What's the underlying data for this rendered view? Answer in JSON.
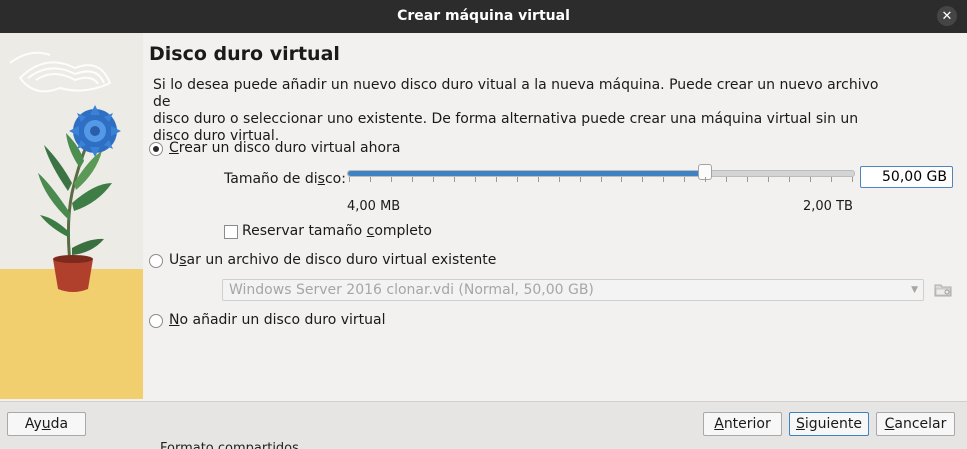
{
  "window": {
    "title": "Crear máquina virtual",
    "close_glyph": "✕"
  },
  "page": {
    "heading": "Disco duro virtual",
    "description_line1": "Si lo desea puede añadir un nuevo disco duro vitual a la nueva máquina. Puede crear un nuevo archivo de",
    "description_line2": "disco duro o seleccionar uno existente. De forma alternativa puede crear una máquina virtual sin un",
    "description_line3": "disco duro virtual."
  },
  "options": {
    "create_new": {
      "label_pre": "",
      "label_ul": "C",
      "label_post": "rear un disco duro virtual ahora",
      "selected": true
    },
    "use_existing": {
      "label_pre": "U",
      "label_ul": "s",
      "label_post": "ar un archivo de disco duro virtual existente",
      "selected": false
    },
    "no_disk": {
      "label_pre": "",
      "label_ul": "N",
      "label_post": "o añadir un disco duro virtual",
      "selected": false
    }
  },
  "disk_size": {
    "label_pre": "Tamaño de di",
    "label_ul": "s",
    "label_post": "co:",
    "value": "50,00 GB",
    "slider_fraction": 0.705,
    "min_label": "4,00 MB",
    "max_label": "2,00 TB"
  },
  "reserve": {
    "label_pre": "Reservar tamaño ",
    "label_ul": "c",
    "label_post": "ompleto",
    "checked": false
  },
  "existing_file": {
    "selected_value": "Windows Server 2016 clonar.vdi (Normal, 50,00 GB)",
    "arrow_glyph": "▼"
  },
  "buttons": {
    "help": {
      "pre": "Ay",
      "ul": "u",
      "post": "da"
    },
    "back": {
      "pre": "",
      "ul": "A",
      "post": "nterior"
    },
    "next": {
      "pre": "",
      "ul": "S",
      "post": "iguiente"
    },
    "cancel": {
      "pre": "",
      "ul": "C",
      "post": "ancelar"
    }
  },
  "background_text": "Formato compartidos",
  "colors": {
    "titlebar": "#2c2c2c",
    "accent": "#3d82c3",
    "panel": "#f2f1f0",
    "illustration_sand": "#f2cf6e"
  }
}
